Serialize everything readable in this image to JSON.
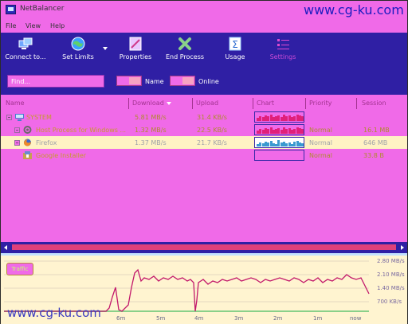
{
  "app": {
    "title": "NetBalancer",
    "watermark": "www.cg-ku.com"
  },
  "menu": [
    "File",
    "View",
    "Help"
  ],
  "toolbar": {
    "connect": "Connect to...",
    "set_limits": "Set Limits",
    "properties": "Properties",
    "end_process": "End Process",
    "usage": "Usage",
    "settings": "Settings"
  },
  "filter": {
    "placeholder": "Find...",
    "name_label": "Name",
    "online_label": "Online"
  },
  "table": {
    "columns": [
      "Name",
      "Download",
      "Upload",
      "Chart",
      "Priority",
      "Session"
    ],
    "rows": [
      {
        "name": "SYSTEM",
        "download": "5.81 MB/s",
        "upload": "31.4 KB/s",
        "priority": "",
        "session": "",
        "level": 0,
        "icon": "computer-icon",
        "selected": false,
        "chart": "magenta"
      },
      {
        "name": "Host Process for Windows ...",
        "download": "1.32 MB/s",
        "upload": "22.5 KB/s",
        "priority": "Normal",
        "session": "16.1 MB",
        "level": 1,
        "icon": "gear-icon",
        "selected": false,
        "chart": "magenta"
      },
      {
        "name": "Firefox",
        "download": "1.37 MB/s",
        "upload": "21.7 KB/s",
        "priority": "Normal",
        "session": "646 MB",
        "level": 1,
        "icon": "firefox-icon",
        "selected": true,
        "chart": "blue"
      },
      {
        "name": "Google Installer",
        "download": "",
        "upload": "",
        "priority": "Normal",
        "session": "33.8 B",
        "level": 1,
        "icon": "installer-icon",
        "selected": false,
        "chart": "empty"
      }
    ]
  },
  "graph": {
    "button": "Traffic",
    "y_labels": [
      "2.80 MB/s",
      "2.10 MB/s",
      "1.40 MB/s",
      "700 KB/s"
    ],
    "x_labels": [
      "6m",
      "5m",
      "4m",
      "3m",
      "2m",
      "1m",
      "now"
    ],
    "colors": {
      "download": "#c2186b",
      "upload": "#7bc043"
    }
  }
}
